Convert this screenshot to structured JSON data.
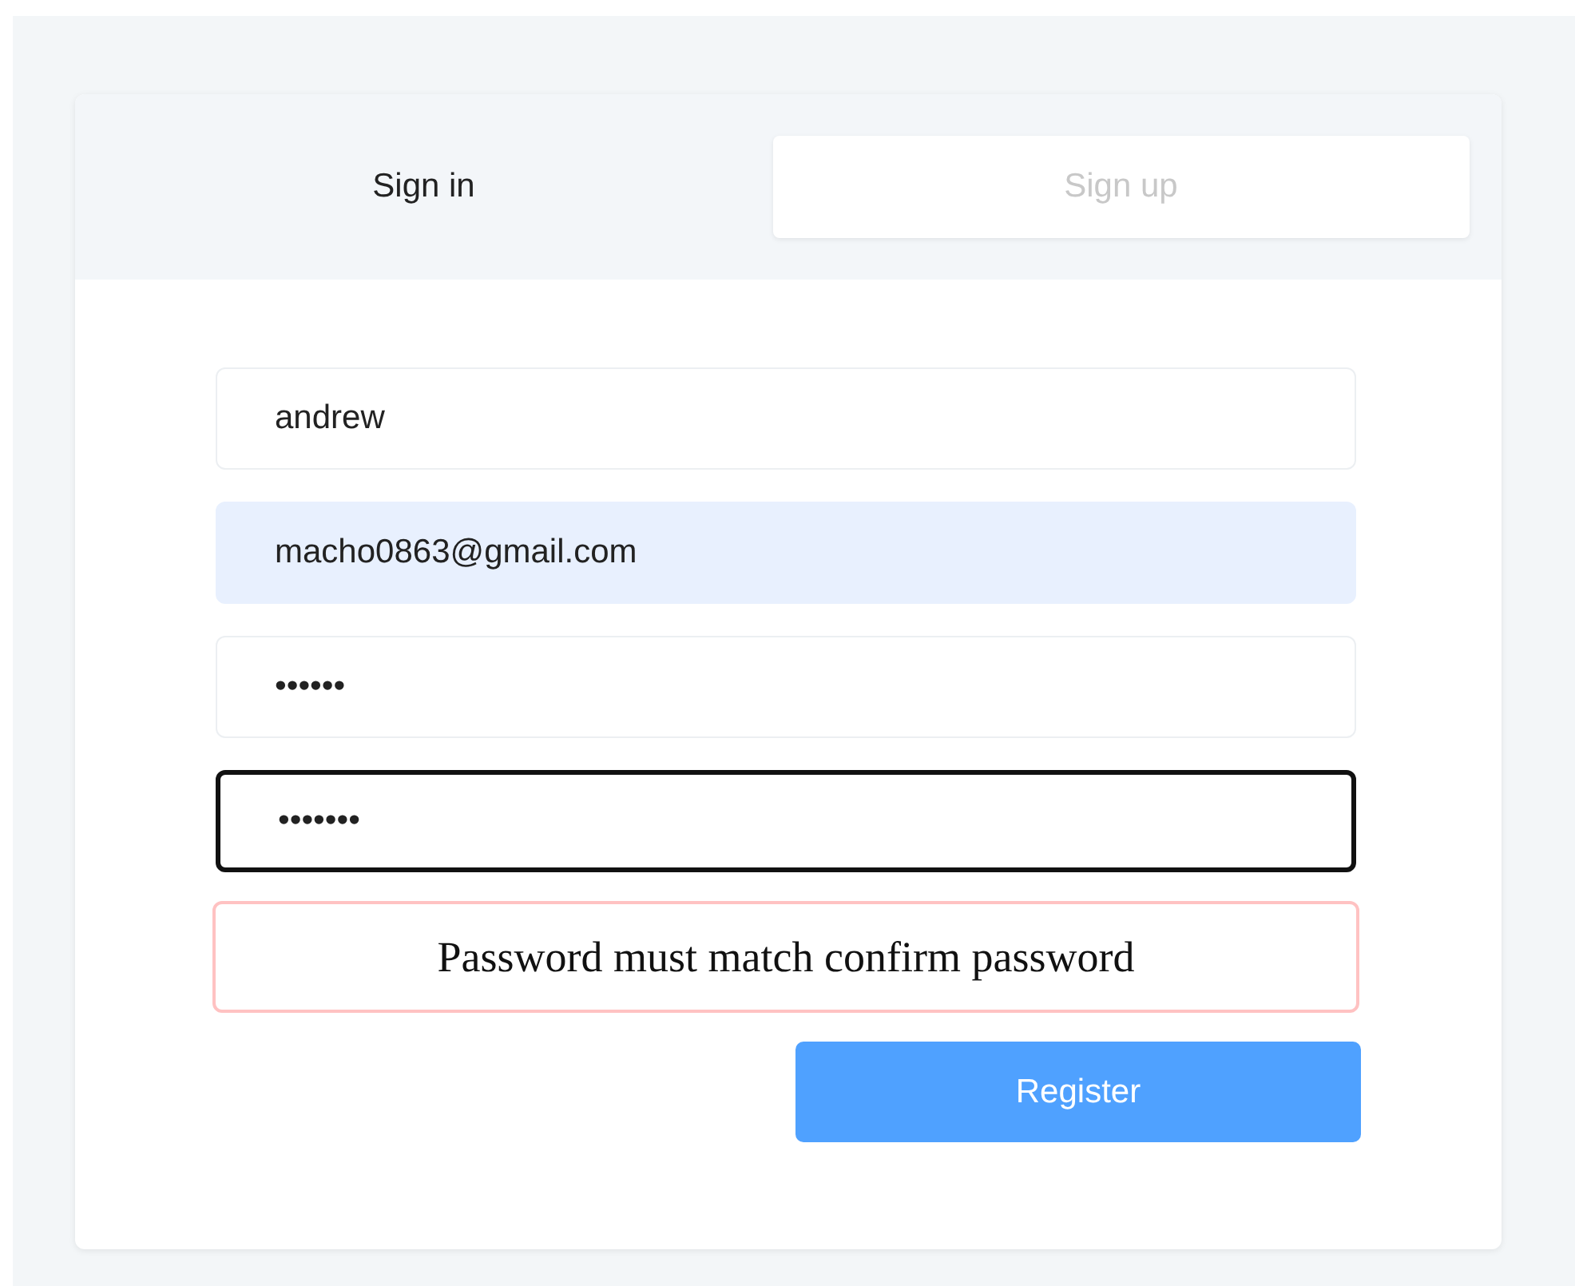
{
  "tabs": [
    {
      "label": "Sign in",
      "selected": false
    },
    {
      "label": "Sign up",
      "selected": true
    }
  ],
  "fields": [
    {
      "value": "andrew",
      "autofilled": false,
      "focused": false
    },
    {
      "value": "macho0863@gmail.com",
      "autofilled": true,
      "focused": false
    },
    {
      "value": "••••••",
      "autofilled": false,
      "focused": false
    },
    {
      "value": "•••••••",
      "autofilled": false,
      "focused": true
    }
  ],
  "error": "Password must match confirm password",
  "submit_button": "Register"
}
